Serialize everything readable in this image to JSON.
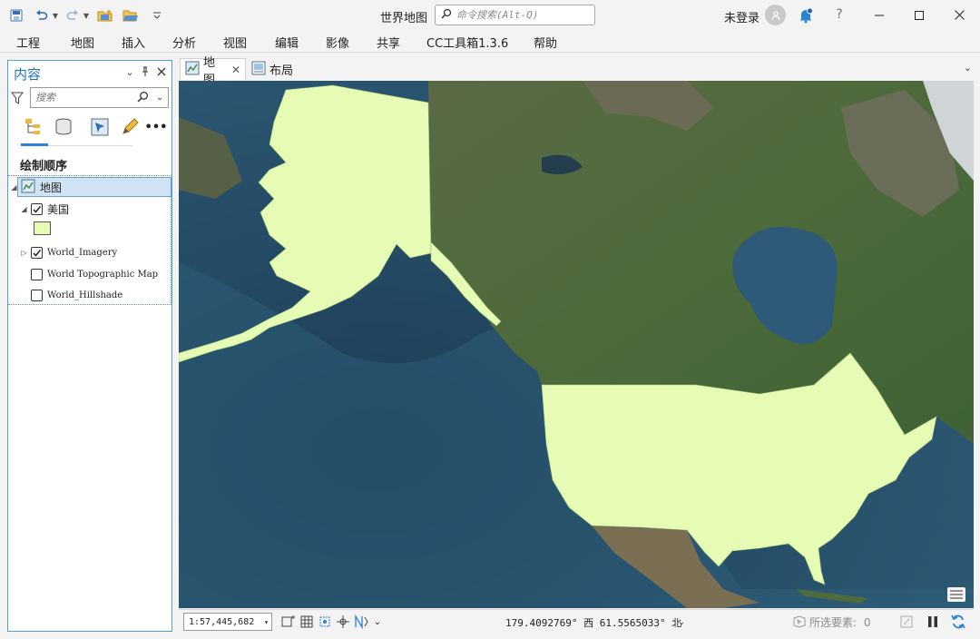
{
  "window": {
    "title": "世界地图",
    "command_search_placeholder": "命令搜索(Alt-Q)",
    "user": "未登录",
    "help": "?"
  },
  "ribbon": {
    "tabs": [
      "工程",
      "地图",
      "插入",
      "分析",
      "视图",
      "编辑",
      "影像",
      "共享",
      "CC工具箱1.3.6",
      "帮助"
    ]
  },
  "contents": {
    "title": "内容",
    "search_placeholder": "搜索",
    "more": "•••",
    "heading": "绘制顺序",
    "map_name": "地图",
    "layers": [
      {
        "name": "美国",
        "checked": true,
        "expanded": true,
        "symbol_color": "#e6fcb4"
      },
      {
        "name": "World_Imagery",
        "checked": true,
        "expanded": false
      },
      {
        "name": "World Topographic Map",
        "checked": false
      },
      {
        "name": "World_Hillshade",
        "checked": false
      }
    ]
  },
  "view_tabs": [
    {
      "label": "地图",
      "active": true
    },
    {
      "label": "布局",
      "active": false
    }
  ],
  "map": {
    "highlight_color": "#e6fcb4",
    "ocean_color": "#2f5770"
  },
  "status": {
    "scale": "1:57,445,682",
    "coordinates": "179.4092769° 西  61.5565033° 北",
    "selected_label": "所选要素:",
    "selected_count": "0"
  }
}
